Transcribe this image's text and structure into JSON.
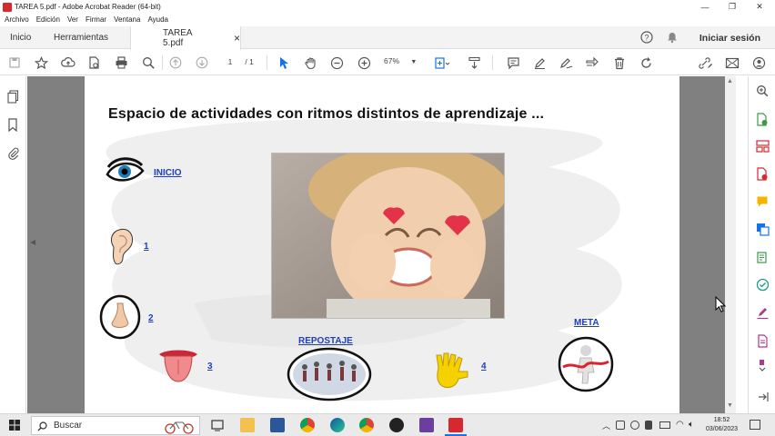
{
  "window": {
    "title": "TAREA 5.pdf - Adobe Acrobat Reader (64-bit)",
    "controls": {
      "minimize": "—",
      "restore": "❐",
      "close": "✕"
    }
  },
  "menu": [
    "Archivo",
    "Edición",
    "Ver",
    "Firmar",
    "Ventana",
    "Ayuda"
  ],
  "tabs": {
    "home": "Inicio",
    "tools": "Herramientas",
    "document": "TAREA 5.pdf",
    "close": "×",
    "sign_in": "Iniciar sesión"
  },
  "toolbar": {
    "page_current": "1",
    "page_total": "/ 1",
    "zoom": "67%"
  },
  "document": {
    "heading": "Espacio de actividades con ritmos distintos de aprendizaje ...",
    "labels": {
      "inicio": "INICIO",
      "one": "1",
      "two": "2",
      "three": "3",
      "four": "4",
      "repostaje": "REPOSTAJE",
      "meta": "META"
    }
  },
  "taskbar": {
    "search_placeholder": "Buscar",
    "time": "18:52",
    "date": "03/06/2023"
  },
  "colors": {
    "accent": "#1473e6",
    "acrobat_red": "#d7282f",
    "link_blue": "#1f3fbf"
  }
}
